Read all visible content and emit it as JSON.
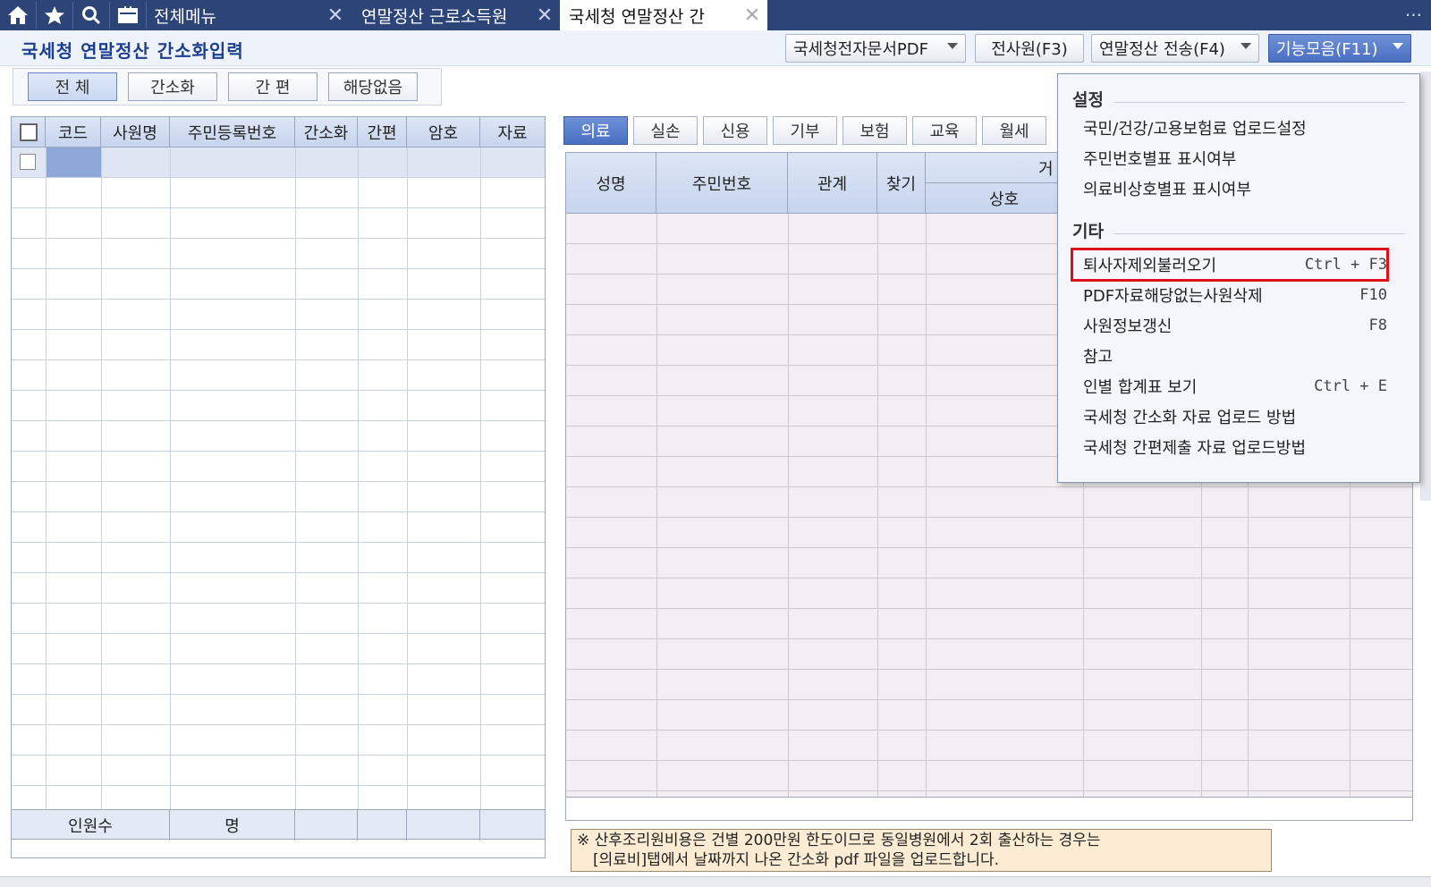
{
  "topbar": {
    "icons": [
      "home-icon",
      "star-icon",
      "search-icon",
      "calendar-icon"
    ],
    "menu_label": "전체메뉴",
    "tabs": [
      {
        "label": "연말정산 근로소득원"
      },
      {
        "label": "국세청 연말정산 간"
      }
    ],
    "close_glyph": "✕",
    "more_glyph": "···"
  },
  "titlebar": {
    "title": "국세청 연말정산 간소화입력",
    "buttons": {
      "pdf": "국세청전자문서PDF",
      "all_employees": "전사원(F3)",
      "transfer": "연말정산 전송(F4)",
      "functions": "기능모음(F11)"
    }
  },
  "filters": [
    "전 체",
    "간소화",
    "간 편",
    "해당없음"
  ],
  "left_grid": {
    "columns": [
      "코드",
      "사원명",
      "주민등록번호",
      "간소화",
      "간편",
      "암호",
      "자료"
    ],
    "footer": {
      "label": "인원수",
      "unit": "명"
    }
  },
  "right_tabs": [
    "의료",
    "실손",
    "신용",
    "기부",
    "보험",
    "교육",
    "월세"
  ],
  "right_grid": {
    "columns": [
      "성명",
      "주민번호",
      "관계",
      "찾기"
    ],
    "group_fragment": "거",
    "sub_header": "상호"
  },
  "note": {
    "line1": "※ 산후조리원비용은 건별 200만원 한도이므로 동일병원에서 2회 출산하는 경우는",
    "line2": "[의료비]탭에서 날짜까지 나온 간소화 pdf 파일을 업로드합니다."
  },
  "menu": {
    "section1": "설정",
    "settings": [
      {
        "label": "국민/건강/고용보험료 업로드설정",
        "key": ""
      },
      {
        "label": "주민번호별표 표시여부",
        "key": ""
      },
      {
        "label": "의료비상호별표 표시여부",
        "key": ""
      }
    ],
    "section2": "기타",
    "others": [
      {
        "label": "퇴사자제외불러오기",
        "key": "Ctrl + F3"
      },
      {
        "label": "PDF자료해당없는사원삭제",
        "key": "F10"
      },
      {
        "label": "사원정보갱신",
        "key": "F8"
      },
      {
        "label": "참고",
        "key": ""
      },
      {
        "label": "인별 합계표 보기",
        "key": "Ctrl + E"
      },
      {
        "label": "국세청 간소화 자료 업로드 방법",
        "key": ""
      },
      {
        "label": "국세청 간편제출 자료 업로드방법",
        "key": ""
      }
    ],
    "highlighted": "퇴사자제외불러오기"
  },
  "colors": {
    "topbar": "#2d4478",
    "accent": "#4a6fc0",
    "highlight": "#e0101b",
    "note_bg": "#fbecd3"
  }
}
